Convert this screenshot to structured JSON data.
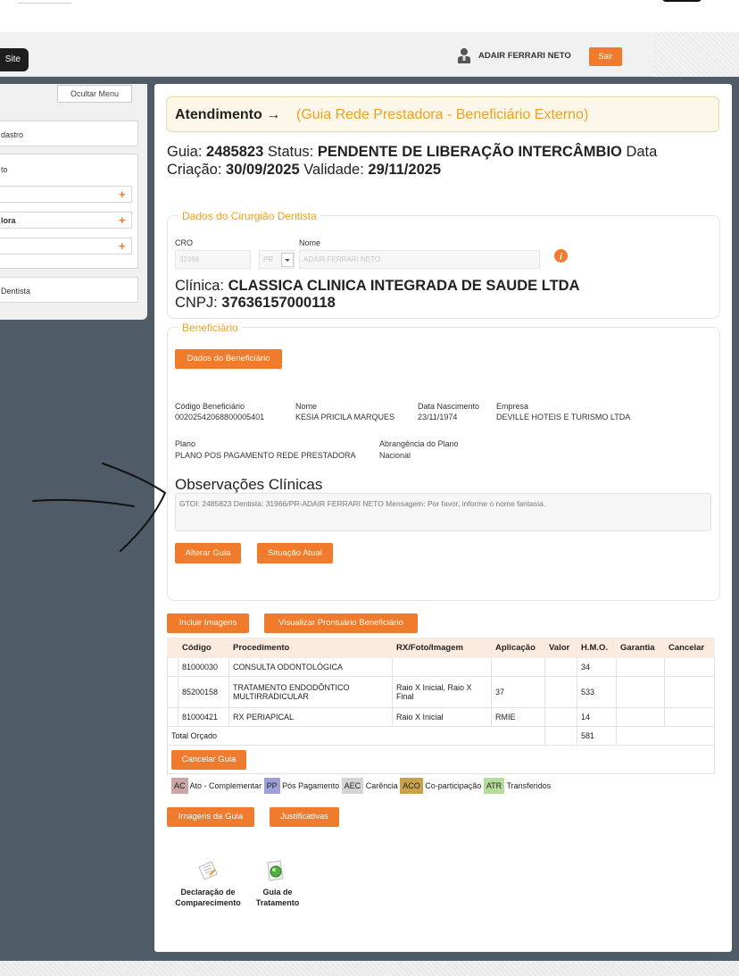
{
  "header": {
    "site_button": "Site",
    "user_name": "ADAIR FERRARI NETO",
    "logout_button": "Sair"
  },
  "sidebar": {
    "hide_menu_button": "Ocultar Menu",
    "items": [
      {
        "label": "dastro"
      },
      {
        "label": "to"
      },
      {
        "label": ""
      },
      {
        "label": "lora"
      },
      {
        "label": ""
      },
      {
        "label": "Dentista"
      }
    ]
  },
  "page": {
    "title": "Atendimento →",
    "subtitle": "(Guia Rede Prestadora - Beneficiário Externo)",
    "guide_line_1": {
      "guia_label": "Guia:",
      "guia_value": "2485823",
      "status_label": "Status:",
      "status_value": "PENDENTE DE LIBERAÇÃO INTERCÂMBIO",
      "data_label": "Data"
    },
    "guide_line_2": {
      "criacao_label": "Criação:",
      "criacao_value": "30/09/2025",
      "validade_label": "Validade:",
      "validade_value": "29/11/2025"
    }
  },
  "dentist": {
    "legend": "Dados do Cirurgião Dentista",
    "cro_label": "CRO",
    "nome_label": "Nome",
    "cro_value": "31966",
    "uf_value": "PR",
    "nome_value": "ADAIR FERRARI NETO",
    "clinica_label": "Clínica:",
    "clinica_value": "CLASSICA CLINICA INTEGRADA DE SAUDE LTDA",
    "cnpj_label": "CNPJ:",
    "cnpj_value": "37636157000118"
  },
  "beneficiary": {
    "legend": "Beneficiário",
    "data_button": "Dados do Beneficiário",
    "codigo_label": "Código Beneficiário",
    "codigo_value": "00202542068800005401",
    "nome_label": "Nome",
    "nome_value": "KESIA PRICILA MARQUES",
    "nasc_label": "Data Nascimento",
    "nasc_value": "23/11/1974",
    "empresa_label": "Empresa",
    "empresa_value": "DEVILLE HOTEIS E TURISMO LTDA",
    "plano_label": "Plano",
    "plano_value": "PLANO POS PAGAMENTO REDE PRESTADORA",
    "abrangencia_label": "Abrangência do Plano",
    "abrangencia_value": "Nacional",
    "obs_title": "Observações Clínicas",
    "obs_text": "GTOI: 2485823 Dentista: 31966/PR-ADAIR FERRARI NETO Mensagem: Por favor, informe o nome fantasia.",
    "alterar_button": "Alterar Guia",
    "situacao_button": "Situação Atual"
  },
  "actions": {
    "incluir_imagens": "Incluir Imagens",
    "visualizar_prontuario": "Visualizar Prontuário Beneficiário"
  },
  "table": {
    "headers": [
      "",
      "Código",
      "Procedimento",
      "RX/Foto/Imagem",
      "Aplicação",
      "Valor",
      "H.M.O.",
      "Garantia",
      "Cancelar"
    ],
    "rows": [
      {
        "codigo": "81000030",
        "procedimento": "CONSULTA ODONTOLÓGICA",
        "rx": "",
        "aplicacao": "",
        "valor": "",
        "hmo": "34",
        "garantia": "",
        "cancelar": ""
      },
      {
        "codigo": "85200158",
        "procedimento": "TRATAMENTO ENDODÔNTICO MULTIRRADICULAR",
        "rx": "Raio X Inicial, Raio X Final",
        "aplicacao": "37",
        "valor": "",
        "hmo": "533",
        "garantia": "",
        "cancelar": ""
      },
      {
        "codigo": "81000421",
        "procedimento": "RX PERIAPICAL",
        "rx": "Raio X Inicial",
        "aplicacao": "RMIE",
        "valor": "",
        "hmo": "14",
        "garantia": "",
        "cancelar": ""
      }
    ],
    "total_label": "Total Orçado",
    "total_hmo": "581",
    "cancelar_guia": "Cancelar Guia"
  },
  "legend_row": [
    {
      "code": "AC",
      "label": "Ato - Complementar",
      "color": "#c9a5a5"
    },
    {
      "code": "PP",
      "label": "Pós Pagamento",
      "color": "#9fa0d8"
    },
    {
      "code": "AEC",
      "label": "Carência",
      "color": "#d4d4d4"
    },
    {
      "code": "ACO",
      "label": "Co-participação",
      "color": "#c8a24a"
    },
    {
      "code": "ATR",
      "label": "Transferidos",
      "color": "#b5dc9a"
    }
  ],
  "bottom_buttons": {
    "imagens_guia": "Imagens da Guia",
    "justificativas": "Justificativas"
  },
  "documents": [
    {
      "line1": "Declaração de",
      "line2": "Comparecimento",
      "icon": "declaration-icon"
    },
    {
      "line1": "Guia de",
      "line2": "Tratamento",
      "icon": "treatment-guide-icon"
    }
  ],
  "colors": {
    "accent": "#f07b2c",
    "legend": "#f0a020",
    "background": "#4f5b66"
  }
}
